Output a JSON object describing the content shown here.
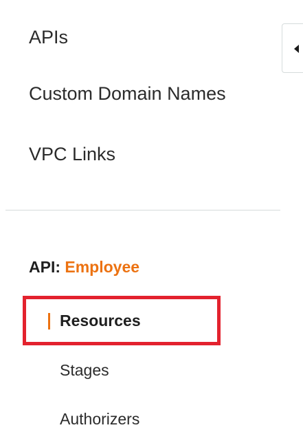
{
  "nav": {
    "top_items": [
      {
        "label": "APIs"
      },
      {
        "label": "Custom Domain Names"
      },
      {
        "label": "VPC Links"
      }
    ]
  },
  "api_section": {
    "prefix": "API:",
    "api_name": "Employee",
    "items": [
      {
        "label": "Resources",
        "active": true
      },
      {
        "label": "Stages"
      },
      {
        "label": "Authorizers"
      }
    ]
  },
  "colors": {
    "accent": "#ec7211",
    "highlight": "#e3222e",
    "divider": "#d5dbdb"
  },
  "icons": {
    "collapse": "caret-left-icon"
  }
}
